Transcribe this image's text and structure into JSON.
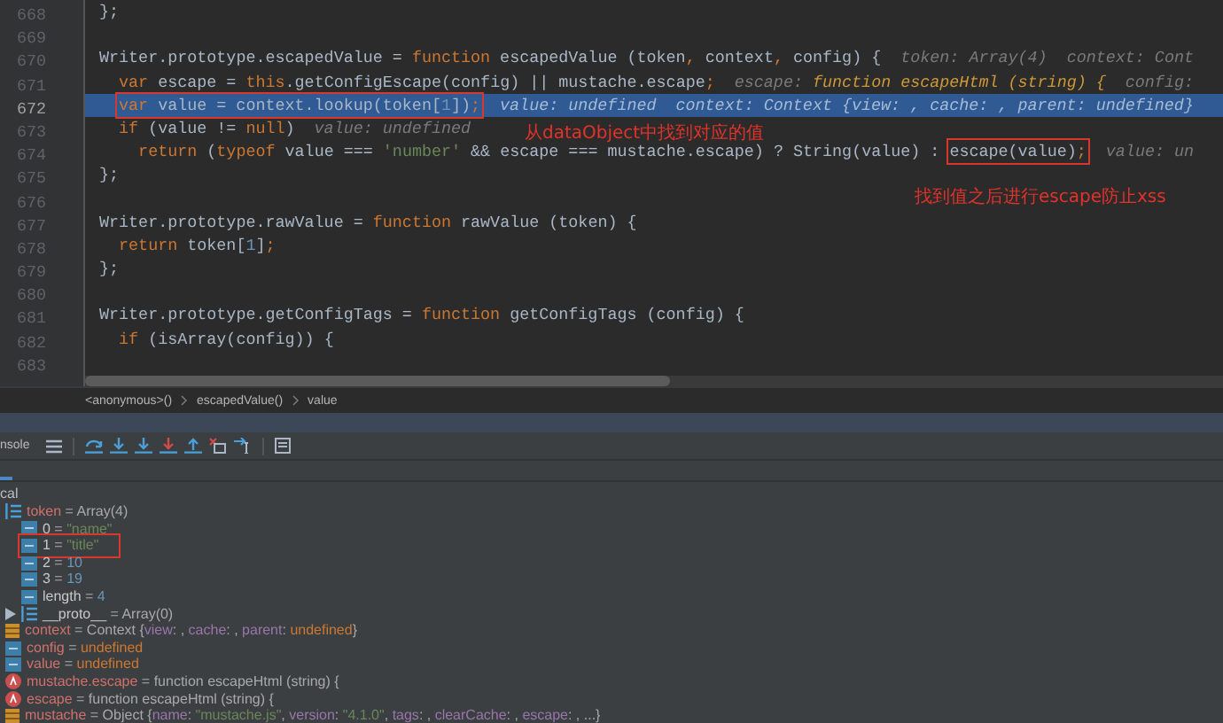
{
  "editor": {
    "lines": [
      {
        "number": "668",
        "current": false,
        "code": [
          {
            "text": "};",
            "kind": "plain"
          }
        ]
      },
      {
        "number": "669",
        "current": false
      },
      {
        "number": "670",
        "current": false,
        "code": [
          {
            "text": "Writer.prototype.escapedValue = ",
            "kind": "plain"
          },
          {
            "text": "function",
            "kind": "kw"
          },
          {
            "text": " escapedValue (token",
            "kind": "plain"
          },
          {
            "text": ",",
            "kind": "kw"
          },
          {
            "text": " context",
            "kind": "plain"
          },
          {
            "text": ",",
            "kind": "kw"
          },
          {
            "text": " config) {",
            "kind": "plain"
          }
        ],
        "hints": [
          {
            "parts": [
              {
                "text": "token: Array(4)",
                "kind": "hint"
              }
            ]
          },
          {
            "parts": [
              {
                "text": "context: Cont",
                "kind": "hint"
              }
            ]
          }
        ]
      },
      {
        "number": "671",
        "current": false,
        "code": [
          {
            "text": "  var",
            "kind": "kw"
          },
          {
            "text": " escape = ",
            "kind": "plain"
          },
          {
            "text": "this",
            "kind": "kw"
          },
          {
            "text": ".getConfigEscape(config) || mustache.escape",
            "kind": "plain"
          },
          {
            "text": ";",
            "kind": "kw"
          }
        ],
        "hints": [
          {
            "parts": [
              {
                "text": "escape: ",
                "kind": "hint"
              },
              {
                "text": "function escapeHtml (string) {",
                "kind": "hint-fn"
              }
            ]
          },
          {
            "parts": [
              {
                "text": "config:",
                "kind": "hint"
              }
            ]
          }
        ]
      },
      {
        "number": "672",
        "current": true,
        "code": [
          {
            "kind": "boxed",
            "parts": [
              {
                "text": "var",
                "kind": "kw"
              },
              {
                "text": " value = context.lookup(token[",
                "kind": "plain"
              },
              {
                "text": "1",
                "kind": "num"
              },
              {
                "text": "])",
                "kind": "plain"
              },
              {
                "text": ";",
                "kind": "kw"
              }
            ]
          }
        ],
        "hints": [
          {
            "parts": [
              {
                "text": "value: undefined",
                "kind": "hint"
              }
            ]
          },
          {
            "parts": [
              {
                "text": "context: Context {view: , cache: , parent: undefined}",
                "kind": "hint"
              }
            ]
          }
        ]
      },
      {
        "number": "673",
        "current": false,
        "code": [
          {
            "text": "  if",
            "kind": "kw"
          },
          {
            "text": " (value != ",
            "kind": "plain"
          },
          {
            "text": "null",
            "kind": "kw"
          },
          {
            "text": ")",
            "kind": "plain"
          }
        ],
        "hints": [
          {
            "parts": [
              {
                "text": "value: undefined",
                "kind": "hint"
              }
            ]
          }
        ]
      },
      {
        "number": "674",
        "current": false,
        "code": [
          {
            "text": "    return",
            "kind": "kw"
          },
          {
            "text": " (",
            "kind": "plain"
          },
          {
            "text": "typeof",
            "kind": "kw"
          },
          {
            "text": " value === ",
            "kind": "plain"
          },
          {
            "text": "'number'",
            "kind": "str"
          },
          {
            "text": " && escape === mustache.escape) ? String(value) : ",
            "kind": "plain"
          },
          {
            "kind": "boxed",
            "parts": [
              {
                "text": "escape(value)",
                "kind": "plain"
              },
              {
                "text": ";",
                "kind": "kw"
              }
            ]
          }
        ],
        "hints": [
          {
            "parts": [
              {
                "text": "value: un",
                "kind": "hint"
              }
            ]
          }
        ]
      },
      {
        "number": "675",
        "current": false,
        "code": [
          {
            "text": "};",
            "kind": "plain"
          }
        ]
      },
      {
        "number": "676",
        "current": false
      },
      {
        "number": "677",
        "current": false,
        "code": [
          {
            "text": "Writer.prototype.rawValue = ",
            "kind": "plain"
          },
          {
            "text": "function",
            "kind": "kw"
          },
          {
            "text": " rawValue (token) {",
            "kind": "plain"
          }
        ]
      },
      {
        "number": "678",
        "current": false,
        "code": [
          {
            "text": "  return",
            "kind": "kw"
          },
          {
            "text": " token[",
            "kind": "plain"
          },
          {
            "text": "1",
            "kind": "num"
          },
          {
            "text": "]",
            "kind": "plain"
          },
          {
            "text": ";",
            "kind": "kw"
          }
        ]
      },
      {
        "number": "679",
        "current": false,
        "code": [
          {
            "text": "};",
            "kind": "plain"
          }
        ]
      },
      {
        "number": "680",
        "current": false
      },
      {
        "number": "681",
        "current": false,
        "code": [
          {
            "text": "Writer.prototype.getConfigTags = ",
            "kind": "plain"
          },
          {
            "text": "function",
            "kind": "kw"
          },
          {
            "text": " getConfigTags (config) {",
            "kind": "plain"
          }
        ]
      },
      {
        "number": "682",
        "current": false,
        "code": [
          {
            "text": "  if",
            "kind": "kw"
          },
          {
            "text": " (isArray(config)) {",
            "kind": "plain"
          }
        ]
      },
      {
        "number": "683",
        "current": false
      }
    ],
    "annotations": [
      "从dataObject中找到对应的值",
      "找到值之后进行escape防止xss"
    ]
  },
  "breadcrumb": [
    "<anonymous>()",
    "escapedValue()",
    "value"
  ],
  "debugger": {
    "console_tab": "nsole",
    "scope_label": "cal",
    "variables": [
      {
        "kind": "array",
        "name": "token",
        "expanded": true,
        "value": [
          {
            "text": " = Array(4)",
            "kind": "plain"
          }
        ],
        "children": [
          {
            "kind": "primitive",
            "name": "0",
            "value": [
              {
                "text": " = ",
                "kind": "plain"
              },
              {
                "text": "\"name\"",
                "kind": "str"
              }
            ]
          },
          {
            "kind": "primitive",
            "name": "1",
            "boxed": true,
            "value": [
              {
                "text": " = ",
                "kind": "plain"
              },
              {
                "text": "\"title\"",
                "kind": "str"
              }
            ]
          },
          {
            "kind": "primitive",
            "name": "2",
            "value": [
              {
                "text": " = ",
                "kind": "plain"
              },
              {
                "text": "10",
                "kind": "num"
              }
            ]
          },
          {
            "kind": "primitive",
            "name": "3",
            "value": [
              {
                "text": " = ",
                "kind": "plain"
              },
              {
                "text": "19",
                "kind": "num"
              }
            ]
          },
          {
            "kind": "primitive",
            "name": "length",
            "value": [
              {
                "text": " = ",
                "kind": "plain"
              },
              {
                "text": "4",
                "kind": "num"
              }
            ]
          },
          {
            "kind": "array",
            "name": "__proto__",
            "expanded": false,
            "value": [
              {
                "text": " = Array(0)",
                "kind": "plain"
              }
            ]
          }
        ]
      },
      {
        "kind": "object",
        "name": "context",
        "value": [
          {
            "text": " = Context {",
            "kind": "plain"
          },
          {
            "text": "view",
            "kind": "key"
          },
          {
            "text": ": , ",
            "kind": "plain"
          },
          {
            "text": "cache",
            "kind": "key"
          },
          {
            "text": ": , ",
            "kind": "plain"
          },
          {
            "text": "parent",
            "kind": "key"
          },
          {
            "text": ": ",
            "kind": "plain"
          },
          {
            "text": "undefined",
            "kind": "kw"
          },
          {
            "text": "}",
            "kind": "plain"
          }
        ]
      },
      {
        "kind": "primitive",
        "name": "config",
        "value": [
          {
            "text": " = ",
            "kind": "plain"
          },
          {
            "text": "undefined",
            "kind": "kw"
          }
        ]
      },
      {
        "kind": "primitive",
        "name": "value",
        "value": [
          {
            "text": " = ",
            "kind": "plain"
          },
          {
            "text": "undefined",
            "kind": "kw"
          }
        ]
      },
      {
        "kind": "function",
        "name": "mustache.escape",
        "value": [
          {
            "text": " = function escapeHtml (string) {",
            "kind": "plain"
          }
        ]
      },
      {
        "kind": "function",
        "name": "escape",
        "value": [
          {
            "text": " = function escapeHtml (string) {",
            "kind": "plain"
          }
        ]
      },
      {
        "kind": "object",
        "name": "mustache",
        "value": [
          {
            "text": " = Object {",
            "kind": "plain"
          },
          {
            "text": "name",
            "kind": "key"
          },
          {
            "text": ": ",
            "kind": "plain"
          },
          {
            "text": "\"mustache.js\"",
            "kind": "str"
          },
          {
            "text": ", ",
            "kind": "plain"
          },
          {
            "text": "version",
            "kind": "key"
          },
          {
            "text": ": ",
            "kind": "plain"
          },
          {
            "text": "\"4.1.0\"",
            "kind": "str"
          },
          {
            "text": ", ",
            "kind": "plain"
          },
          {
            "text": "tags",
            "kind": "key"
          },
          {
            "text": ": , ",
            "kind": "plain"
          },
          {
            "text": "clearCache",
            "kind": "key"
          },
          {
            "text": ": , ",
            "kind": "plain"
          },
          {
            "text": "escape",
            "kind": "key"
          },
          {
            "text": ": , ...}",
            "kind": "plain"
          }
        ]
      }
    ]
  }
}
